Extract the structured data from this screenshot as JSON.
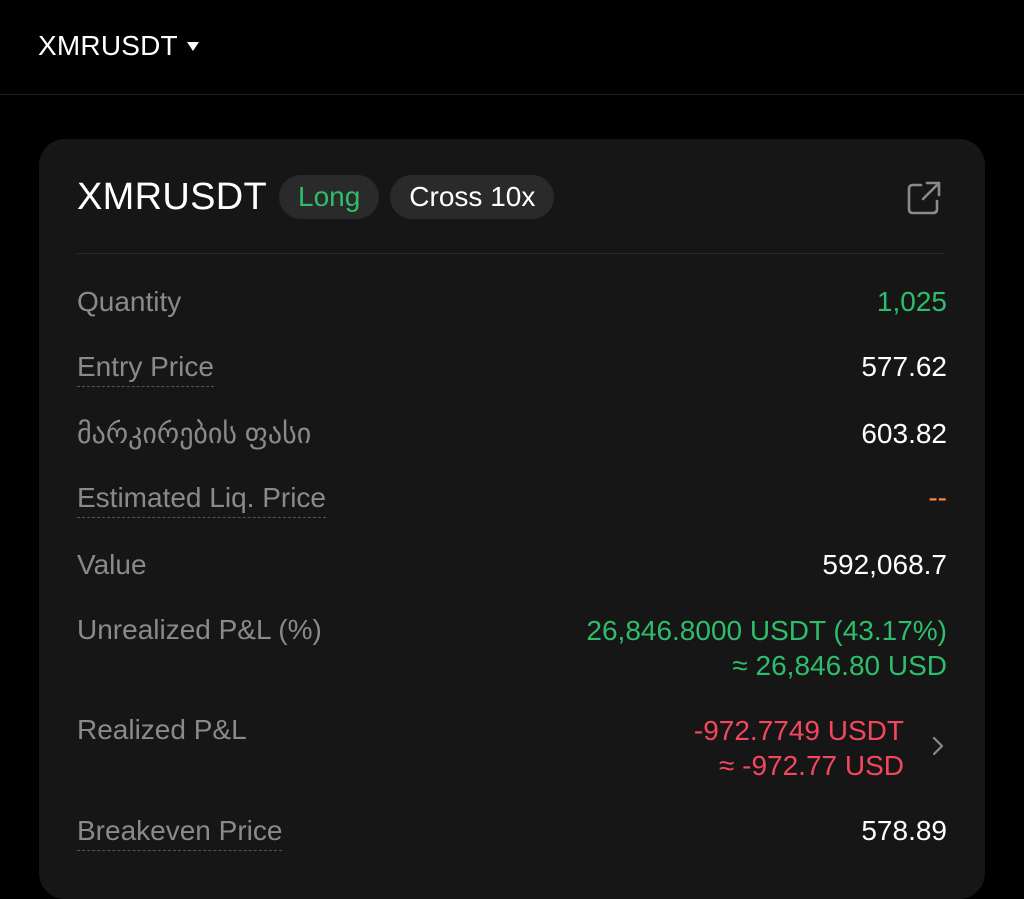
{
  "topbar": {
    "symbol": "XMRUSDT",
    "caret_icon": "caret-down-icon"
  },
  "position": {
    "symbol": "XMRUSDT",
    "side": "Long",
    "margin_mode": "Cross 10x",
    "share_icon": "share-external-icon",
    "colors": {
      "green": "#2ebd6b",
      "red": "#f6465d",
      "orange": "#ff8a3d",
      "label": "#8a8a8a"
    },
    "rows": {
      "quantity": {
        "label": "Quantity",
        "value": "1,025"
      },
      "entry_price": {
        "label": "Entry Price",
        "value": "577.62"
      },
      "mark_price": {
        "label": "მარკირების ფასი",
        "value": "603.82"
      },
      "liq_price": {
        "label": "Estimated Liq. Price",
        "value": "--"
      },
      "value": {
        "label": "Value",
        "value": "592,068.7"
      },
      "unrealized": {
        "label": "Unrealized P&L (%)",
        "value_usdt": "26,846.8000 USDT (43.17%)",
        "value_usd": "≈ 26,846.80 USD"
      },
      "realized": {
        "label": "Realized P&L",
        "value_usdt": "-972.7749 USDT",
        "value_usd": "≈ -972.77 USD",
        "chevron_icon": "chevron-right-icon"
      },
      "breakeven": {
        "label": "Breakeven Price",
        "value": "578.89"
      }
    }
  }
}
